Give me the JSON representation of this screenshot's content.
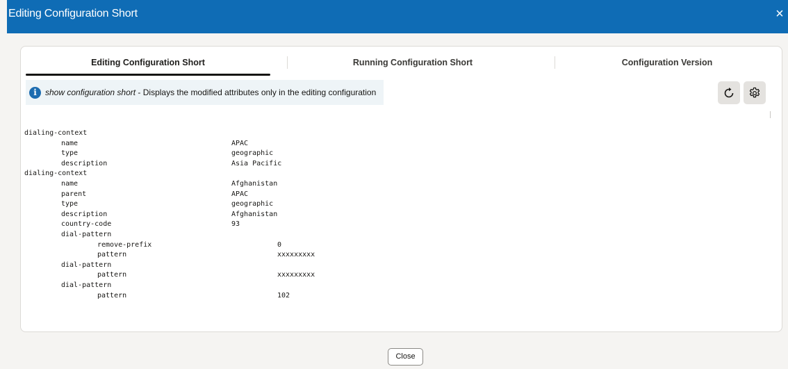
{
  "dialog": {
    "title": "Editing Configuration Short",
    "close_icon": "×",
    "close_button_label": "Close"
  },
  "tabs": [
    {
      "label": "Editing Configuration Short",
      "selected": true
    },
    {
      "label": "Running Configuration Short",
      "selected": false
    },
    {
      "label": "Configuration Version",
      "selected": false
    }
  ],
  "info": {
    "icon": "i",
    "command": "show configuration short",
    "description": " - Displays the modified attributes only in the editing configuration"
  },
  "toolbar": {
    "refresh_icon": "refresh-icon",
    "settings_icon": "gear-icon"
  },
  "config_lines": [
    {
      "key": "dialing-context",
      "value": ""
    },
    {
      "key": "name",
      "value": "APAC"
    },
    {
      "key": "type",
      "value": "geographic"
    },
    {
      "key": "description",
      "value": "Asia Pacific"
    },
    {
      "key": "dialing-context",
      "value": ""
    },
    {
      "key": "name",
      "value": "Afghanistan"
    },
    {
      "key": "parent",
      "value": "APAC"
    },
    {
      "key": "type",
      "value": "geographic"
    },
    {
      "key": "description",
      "value": "Afghanistan"
    },
    {
      "key": "country-code",
      "value": "93"
    },
    {
      "key": "dial-pattern",
      "value": ""
    },
    {
      "key": "remove-prefix",
      "value": "0"
    },
    {
      "key": "pattern",
      "value": "xxxxxxxxx"
    },
    {
      "key": "dial-pattern",
      "value": ""
    },
    {
      "key": "pattern",
      "value": "xxxxxxxxx"
    },
    {
      "key": "dial-pattern",
      "value": ""
    },
    {
      "key": "pattern",
      "value": "102"
    }
  ],
  "colors": {
    "header": "#0f6cb5",
    "info_icon": "#1c6cb0",
    "info_banner": "#eef4f7",
    "page_background": "#f5f4f2"
  }
}
